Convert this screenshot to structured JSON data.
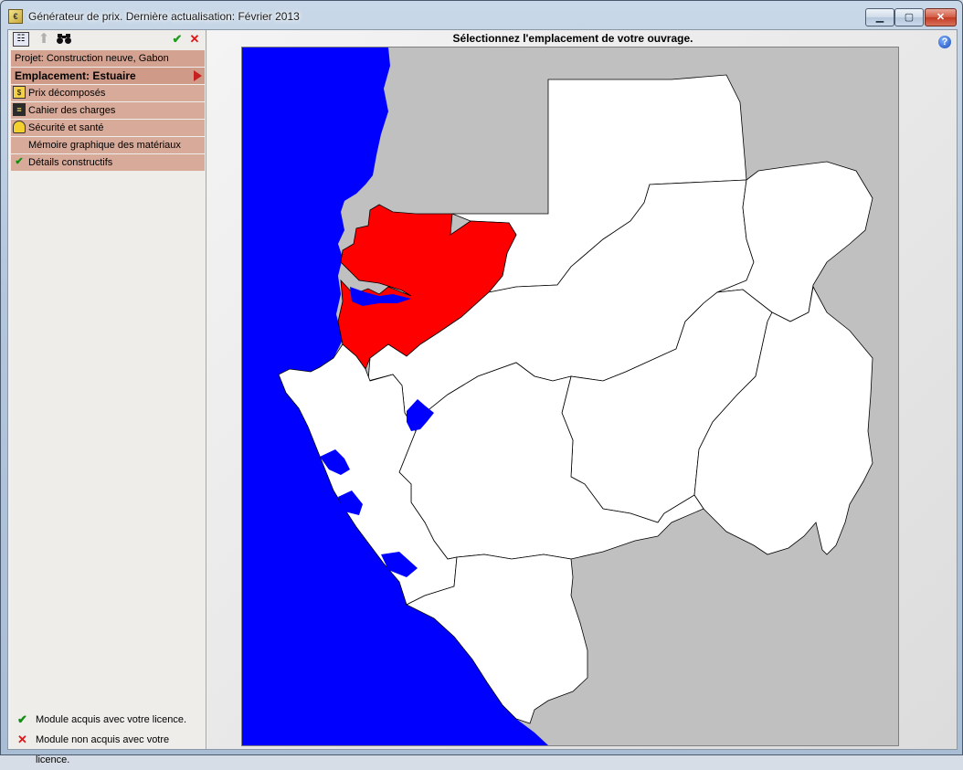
{
  "window": {
    "title": "Générateur de prix. Dernière actualisation: Février 2013",
    "minimize_label": "▁",
    "maximize_label": "▢",
    "close_label": "✕"
  },
  "toolbar": {
    "info_icon": "☷",
    "up_icon": "⬆",
    "find_icon": "🔭",
    "ok_icon": "✔",
    "cancel_icon": "✕"
  },
  "menu": {
    "project_label": "Projet: Construction neuve, Gabon",
    "location_label": "Emplacement: Estuaire",
    "items": [
      {
        "label": "Prix décomposés",
        "icon": "price-doc-icon"
      },
      {
        "label": "Cahier des charges",
        "icon": "book-icon"
      },
      {
        "label": "Sécurité et santé",
        "icon": "helmet-icon"
      },
      {
        "label": "Mémoire graphique des matériaux",
        "icon": ""
      },
      {
        "label": "Détails constructifs",
        "icon": "check-icon"
      }
    ]
  },
  "legend": {
    "acquired": "Module acquis avec votre licence.",
    "not_acquired": "Module non acquis avec votre licence."
  },
  "map": {
    "title": "Sélectionnez l'emplacement de votre ouvrage.",
    "selected_region": "Estuaire",
    "colors": {
      "ocean": "#0000ff",
      "neighbor": "#c0c0c0",
      "province": "#ffffff",
      "selected": "#ff0000",
      "border": "#000000"
    }
  }
}
